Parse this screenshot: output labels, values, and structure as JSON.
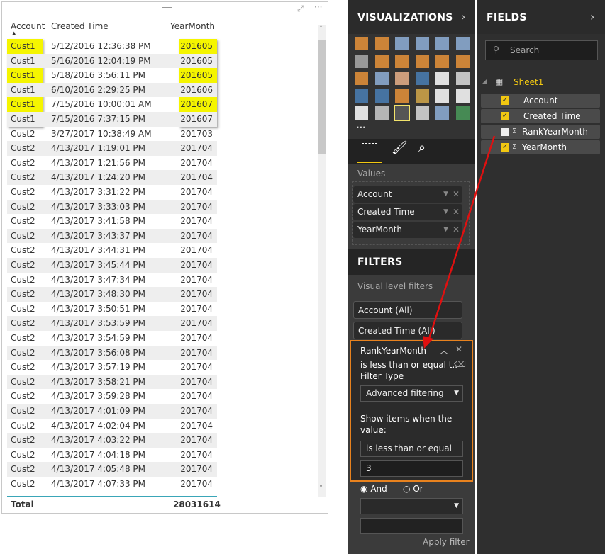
{
  "table": {
    "columns": [
      "Account",
      "Created Time",
      "YearMonth"
    ],
    "rows": [
      [
        "Cust1",
        "5/12/2016 12:36:38 PM",
        "201605"
      ],
      [
        "Cust1",
        "5/16/2016 12:04:19 PM",
        "201605"
      ],
      [
        "Cust1",
        "5/18/2016 3:56:11 PM",
        "201605"
      ],
      [
        "Cust1",
        "6/10/2016 2:29:25 PM",
        "201606"
      ],
      [
        "Cust1",
        "7/15/2016 10:00:01 AM",
        "201607"
      ],
      [
        "Cust1",
        "7/15/2016 7:37:15 PM",
        "201607"
      ],
      [
        "Cust2",
        "3/27/2017 10:38:49 AM",
        "201703"
      ],
      [
        "Cust2",
        "4/13/2017 1:19:01 PM",
        "201704"
      ],
      [
        "Cust2",
        "4/13/2017 1:21:56 PM",
        "201704"
      ],
      [
        "Cust2",
        "4/13/2017 1:24:20 PM",
        "201704"
      ],
      [
        "Cust2",
        "4/13/2017 3:31:22 PM",
        "201704"
      ],
      [
        "Cust2",
        "4/13/2017 3:33:03 PM",
        "201704"
      ],
      [
        "Cust2",
        "4/13/2017 3:41:58 PM",
        "201704"
      ],
      [
        "Cust2",
        "4/13/2017 3:43:37 PM",
        "201704"
      ],
      [
        "Cust2",
        "4/13/2017 3:44:31 PM",
        "201704"
      ],
      [
        "Cust2",
        "4/13/2017 3:45:44 PM",
        "201704"
      ],
      [
        "Cust2",
        "4/13/2017 3:47:34 PM",
        "201704"
      ],
      [
        "Cust2",
        "4/13/2017 3:48:30 PM",
        "201704"
      ],
      [
        "Cust2",
        "4/13/2017 3:50:51 PM",
        "201704"
      ],
      [
        "Cust2",
        "4/13/2017 3:53:59 PM",
        "201704"
      ],
      [
        "Cust2",
        "4/13/2017 3:54:59 PM",
        "201704"
      ],
      [
        "Cust2",
        "4/13/2017 3:56:08 PM",
        "201704"
      ],
      [
        "Cust2",
        "4/13/2017 3:57:19 PM",
        "201704"
      ],
      [
        "Cust2",
        "4/13/2017 3:58:21 PM",
        "201704"
      ],
      [
        "Cust2",
        "4/13/2017 3:59:28 PM",
        "201704"
      ],
      [
        "Cust2",
        "4/13/2017 4:01:09 PM",
        "201704"
      ],
      [
        "Cust2",
        "4/13/2017 4:02:04 PM",
        "201704"
      ],
      [
        "Cust2",
        "4/13/2017 4:03:22 PM",
        "201704"
      ],
      [
        "Cust2",
        "4/13/2017 4:04:18 PM",
        "201704"
      ],
      [
        "Cust2",
        "4/13/2017 4:05:48 PM",
        "201704"
      ],
      [
        "Cust2",
        "4/13/2017 4:07:33 PM",
        "201704"
      ]
    ],
    "highlight_color": "#f5f500",
    "total_label": "Total",
    "total_value": "28031614"
  },
  "viz": {
    "title": "VISUALIZATIONS",
    "more": "...",
    "values_label": "Values",
    "values": [
      "Account",
      "Created Time",
      "YearMonth"
    ]
  },
  "filters": {
    "title": "FILTERS",
    "subtitle": "Visual level filters",
    "items": [
      "Account (All)",
      "Created Time (All)"
    ],
    "active": {
      "name": "RankYearMonth",
      "summary": "is less than or equal t..",
      "filter_type_label": "Filter Type",
      "filter_type": "Advanced filtering",
      "show_label": "Show items when the value:",
      "condition": "is less than or equal to",
      "value": "3",
      "and": "And",
      "or": "Or",
      "apply": "Apply filter"
    },
    "accent": "#e8821e"
  },
  "fields": {
    "title": "FIELDS",
    "search_placeholder": "Search",
    "table": "Sheet1",
    "items": [
      {
        "label": "Account",
        "checked": true
      },
      {
        "label": "Created Time",
        "checked": true
      },
      {
        "label": "RankYearMonth",
        "checked": false
      },
      {
        "label": "YearMonth",
        "checked": true
      }
    ]
  }
}
